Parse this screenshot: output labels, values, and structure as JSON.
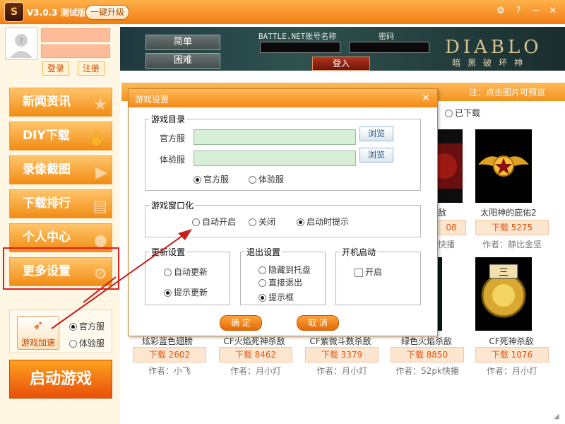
{
  "titlebar": {
    "logo_glyph": "S",
    "version": "V3.0.3 测试版",
    "upgrade_label": "一键升级",
    "settings_glyph": "⚙",
    "help_glyph": "?",
    "minimize_glyph": "−",
    "close_glyph": "✕"
  },
  "account": {
    "login_label": "登录",
    "register_label": "注册"
  },
  "banner": {
    "normal_label": "简单",
    "hard_label": "困难",
    "battlenet_label": "BATTLE.NET账号名称",
    "password_label": "密码",
    "enter_label": "登入",
    "game_title": "DIABLO",
    "game_subtitle": "暗黑破坏神"
  },
  "nav": {
    "items": [
      {
        "label": "新闻资讯",
        "icon": "★"
      },
      {
        "label": "DIY下载",
        "icon": "✋"
      },
      {
        "label": "录像截图",
        "icon": "▶"
      },
      {
        "label": "下载排行",
        "icon": "▤"
      },
      {
        "label": "个人中心",
        "icon": "●"
      },
      {
        "label": "更多设置",
        "icon": "⚙"
      }
    ]
  },
  "accelerator": {
    "button_label": "游戏加速",
    "official_label": "官方服",
    "test_label": "体验服",
    "selected": "官方服"
  },
  "start_label": "启动游戏",
  "content": {
    "tab_note": "注：点击图片可预览",
    "downloaded_label": "已下载",
    "row1": [
      {
        "title": "杀敌",
        "download": "08",
        "author": "快播"
      },
      {
        "title": "太阳神的庇佑2",
        "download": "下载 5275",
        "author": "作者：静比金坚"
      }
    ],
    "row2": [
      {
        "title": "炫彩蓝色翅膀",
        "download": "下载 2602",
        "author": "作者：小飞"
      },
      {
        "title": "CF火焰死神杀敌",
        "download": "下载 8462",
        "author": "作者：月小灯"
      },
      {
        "title": "CF紫微斗数杀敌",
        "download": "下载 3379",
        "author": "作者：月小灯"
      },
      {
        "title": "绿色火焰杀敌",
        "download": "下载 8850",
        "author": "作者：52pk快播"
      },
      {
        "title": "CF死神杀敌",
        "download": "下载 1076",
        "author": "作者：月小灯"
      }
    ]
  },
  "dialog": {
    "title": "游戏设置",
    "close_glyph": "✕",
    "game_dir": {
      "legend": "游戏目录",
      "official_label": "官方服",
      "test_label": "体验服",
      "official_value": "",
      "test_value": "",
      "browse_label": "浏览",
      "radio_official": "官方服",
      "radio_test": "体验服",
      "selected": "官方服"
    },
    "windowed": {
      "legend": "游戏窗口化",
      "auto_on": "自动开启",
      "off": "关闭",
      "prompt": "启动时提示",
      "selected": "启动时提示"
    },
    "update": {
      "legend": "更新设置",
      "auto": "自动更新",
      "prompt": "提示更新",
      "selected": "提示更新"
    },
    "exit": {
      "legend": "退出设置",
      "tray": "隐藏到托盘",
      "direct": "直接退出",
      "prompt": "提示框",
      "selected": "提示框"
    },
    "startup": {
      "legend": "开机启动",
      "enable": "开启",
      "checked": false
    },
    "ok_label": "确 定",
    "cancel_label": "取 消"
  },
  "colors": {
    "accent": "#f38a16",
    "highlight_border": "#e02020",
    "arrow": "#c4201c"
  }
}
